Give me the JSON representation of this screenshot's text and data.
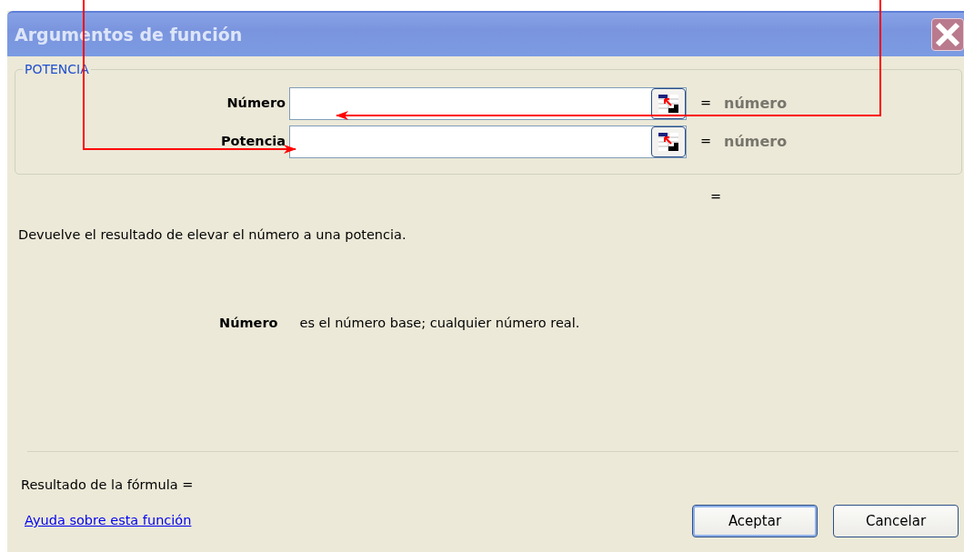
{
  "window": {
    "title": "Argumentos de función"
  },
  "function_group": {
    "name": "POTENCIA",
    "arguments": [
      {
        "label": "Número",
        "equals": "=",
        "hint": "número"
      },
      {
        "label": "Potencia",
        "equals": "=",
        "hint": "número"
      }
    ]
  },
  "result_equals": "=",
  "description": "Devuelve el resultado de elevar el número a una potencia.",
  "argument_help": {
    "name": "Número",
    "text": "es el número base; cualquier número real."
  },
  "formula_result": "Resultado de la fórmula =",
  "help_link": "Ayuda sobre esta función",
  "buttons": [
    {
      "label": "Aceptar",
      "default": true
    },
    {
      "label": "Cancelar",
      "default": false
    }
  ]
}
